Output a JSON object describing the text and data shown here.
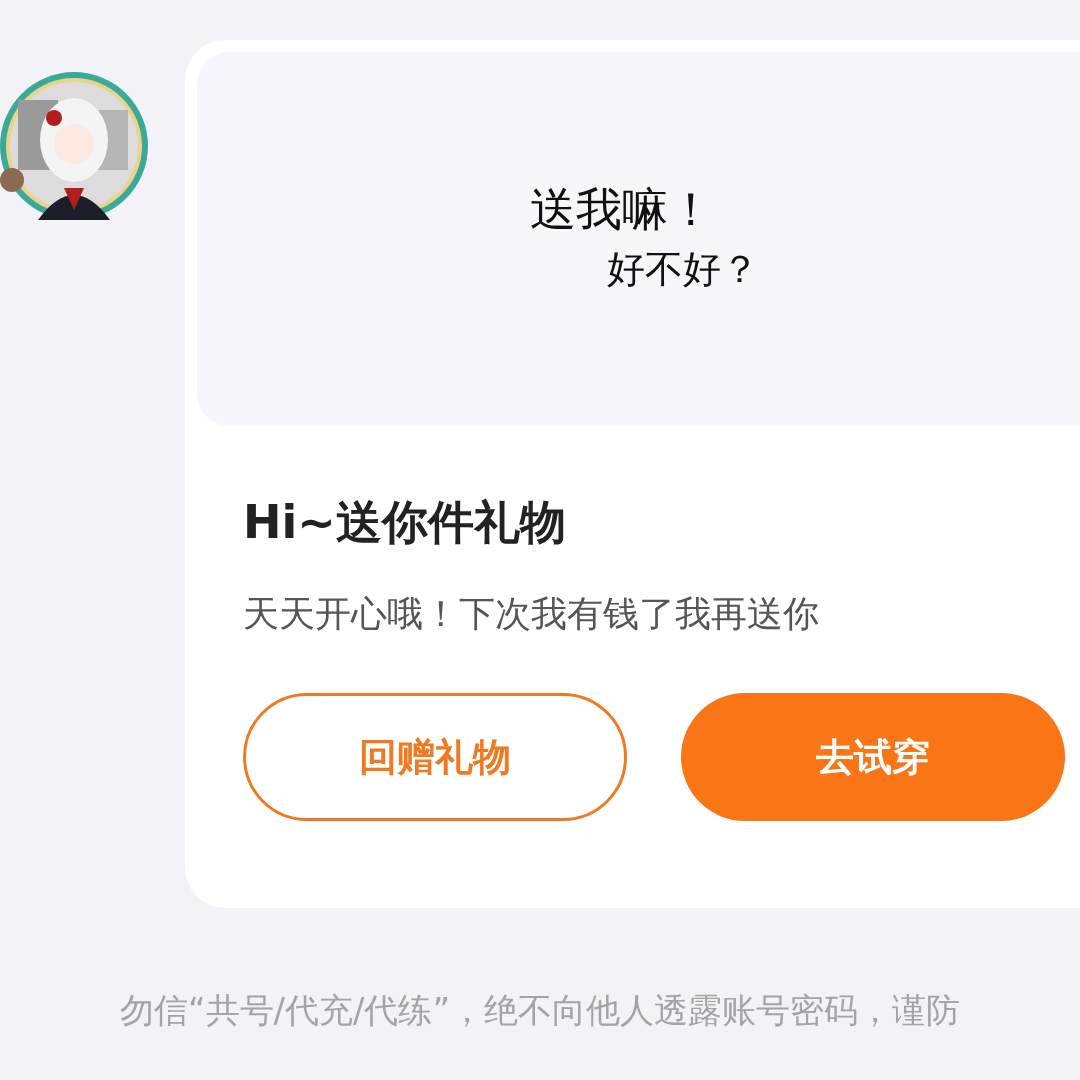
{
  "card": {
    "banner": {
      "caption_lines": [
        "送我嘛！",
        "好不好？"
      ]
    },
    "title": "Hi~送你件礼物",
    "message": "天天开心哦！下次我有钱了我再送你",
    "buttons": [
      {
        "label": "回赠礼物",
        "kind": "outline"
      },
      {
        "label": "去试穿",
        "kind": "filled"
      }
    ]
  },
  "notice": "勿信“共号/代充/代练”，绝不向他人透露账号密码，谨防"
}
